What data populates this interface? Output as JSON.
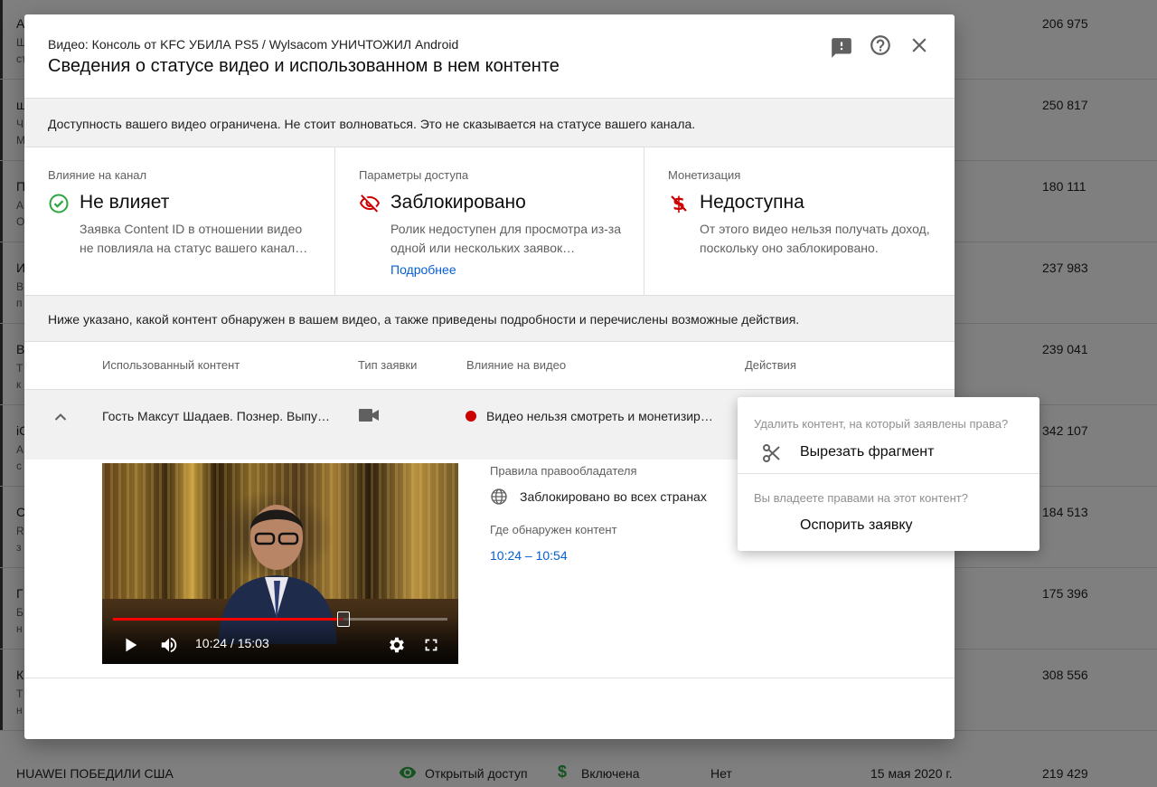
{
  "background": {
    "rows": [
      {
        "t1": "А",
        "t2": "Ш",
        "t3": "ст",
        "views": "206 975"
      },
      {
        "t1": "ш",
        "t2": "Ч",
        "t3": "М",
        "views": "250 817"
      },
      {
        "t1": "П",
        "t2": "А",
        "t3": "О",
        "views": "180 111"
      },
      {
        "t1": "И",
        "t2": "В",
        "t3": "п",
        "views": "237 983"
      },
      {
        "t1": "В",
        "t2": "Т",
        "t3": "к",
        "views": "239 041"
      },
      {
        "t1": "iC",
        "t2": "А",
        "t3": "с",
        "views": "342 107"
      },
      {
        "t1": "С",
        "t2": "R",
        "t3": "з",
        "views": "184 513"
      },
      {
        "t1": "Г",
        "t2": "Б",
        "t3": "н",
        "views": "175 396"
      },
      {
        "t1": "К",
        "t2": "Т",
        "t3": "н",
        "views": "308 556"
      }
    ],
    "last_row": {
      "title": "HUAWEI ПОБЕДИЛИ США",
      "visibility": "Открытый доступ",
      "monetization": "Включена",
      "restrictions": "Нет",
      "date": "15 мая 2020 г.",
      "views": "219 429"
    }
  },
  "dialog": {
    "subtitle": "Видео: Консоль от KFC УБИЛА PS5 / Wylsacom УНИЧТОЖИЛ Android",
    "title": "Сведения о статусе видео и использованном в нем контенте",
    "banner": "Доступность вашего видео ограничена. Не стоит волноваться. Это не сказывается на статусе вашего канала.",
    "cards": [
      {
        "label": "Влияние на канал",
        "value": "Не влияет",
        "desc": "Заявка Content ID в отношении видео не повлияла на статус вашего канал…",
        "link": ""
      },
      {
        "label": "Параметры доступа",
        "value": "Заблокировано",
        "desc": "Ролик недоступен для просмотра из-за одной или нескольких заявок…",
        "link": "Подробнее"
      },
      {
        "label": "Монетизация",
        "value": "Недоступна",
        "desc": "От этого видео нельзя получать доход, поскольку оно заблокировано.",
        "link": ""
      }
    ],
    "banner2": "Ниже указано, какой контент обнаружен в вашем видео, а также приведены подробности и перечислены возможные действия.",
    "table": {
      "headers": [
        "Использованный контент",
        "Тип заявки",
        "Влияние на видео",
        "Действия"
      ],
      "row": {
        "content": "Гость Максут Шадаев. Познер. Выпу…",
        "impact": "Видео нельзя смотреть и монетизир…"
      }
    },
    "details": {
      "rules_label": "Правила правообладателя",
      "rules_value": "Заблокировано во всех странах",
      "found_label": "Где обнаружен контент",
      "found_value": "10:24 – 10:54"
    },
    "player": {
      "time": "10:24 / 15:03",
      "progress": 0.69
    }
  },
  "menu": {
    "q1": "Удалить контент, на который заявлены права?",
    "cut": "Вырезать фрагмент",
    "q2": "Вы владеете правами на этот контент?",
    "dispute": "Оспорить заявку"
  },
  "colors": {
    "accent": "#065fd4",
    "ok": "#2ba640",
    "danger": "#cc0000"
  }
}
